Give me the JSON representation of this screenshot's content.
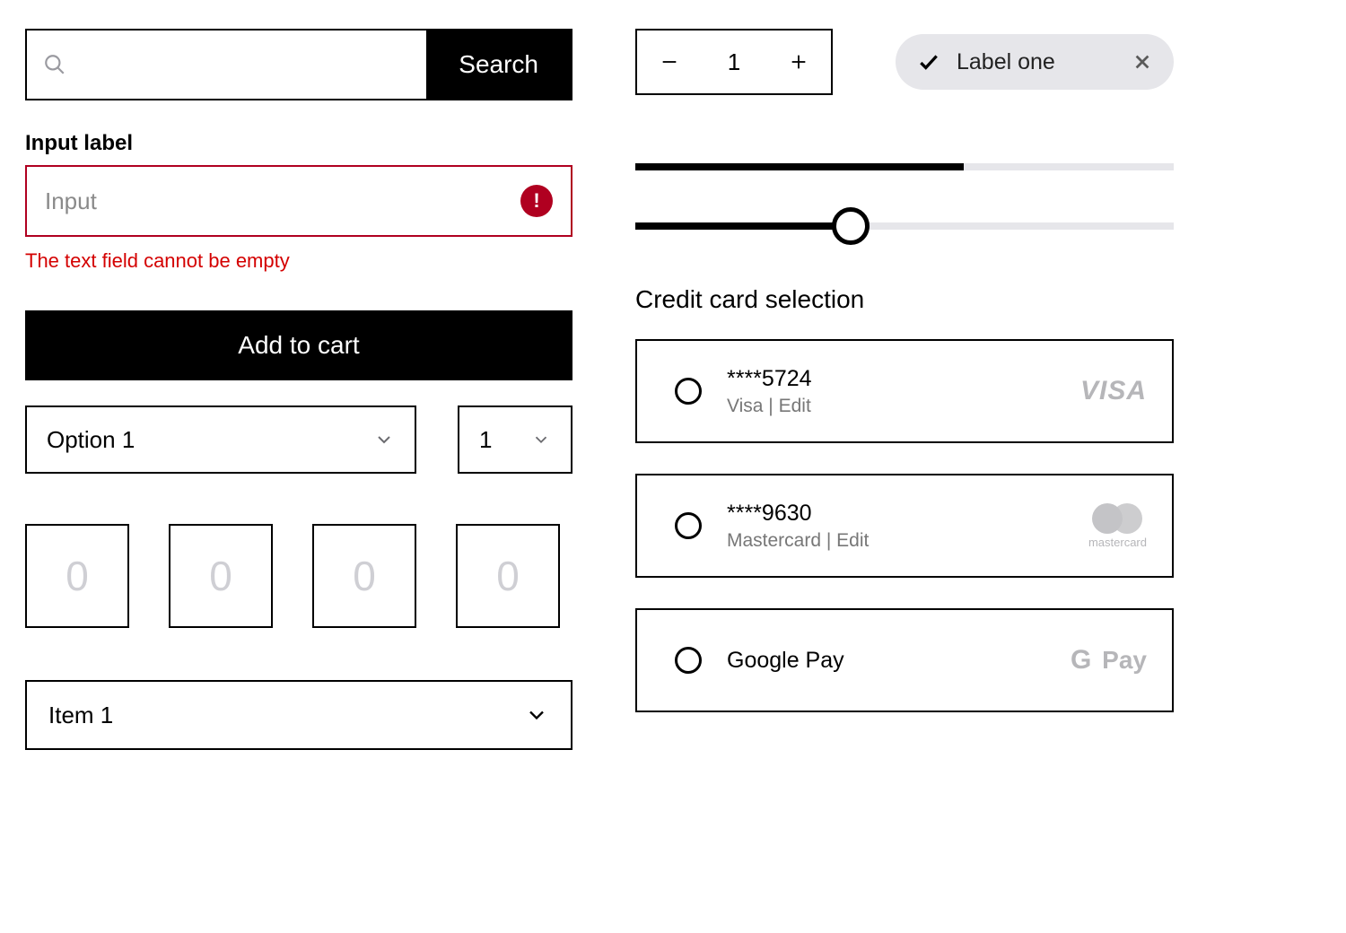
{
  "search": {
    "button_label": "Search",
    "placeholder": ""
  },
  "input_field": {
    "label": "Input label",
    "placeholder": "Input",
    "error_message": "The text field cannot be empty"
  },
  "add_to_cart_label": "Add to cart",
  "option_select": {
    "value": "Option 1"
  },
  "qty_select": {
    "value": "1"
  },
  "otp": {
    "placeholder": "0"
  },
  "item_select": {
    "value": "Item 1"
  },
  "stepper": {
    "value": "1"
  },
  "chip": {
    "label": "Label one"
  },
  "progress": {
    "percent": 61
  },
  "slider": {
    "percent": 40
  },
  "credit_cards": {
    "heading": "Credit card selection",
    "items": [
      {
        "masked": "****5724",
        "sub": "Visa | Edit",
        "brand": "VISA"
      },
      {
        "masked": "****9630",
        "sub": "Mastercard | Edit",
        "brand": "mastercard"
      },
      {
        "masked": "Google Pay",
        "sub": "",
        "brand": "G Pay"
      }
    ]
  }
}
